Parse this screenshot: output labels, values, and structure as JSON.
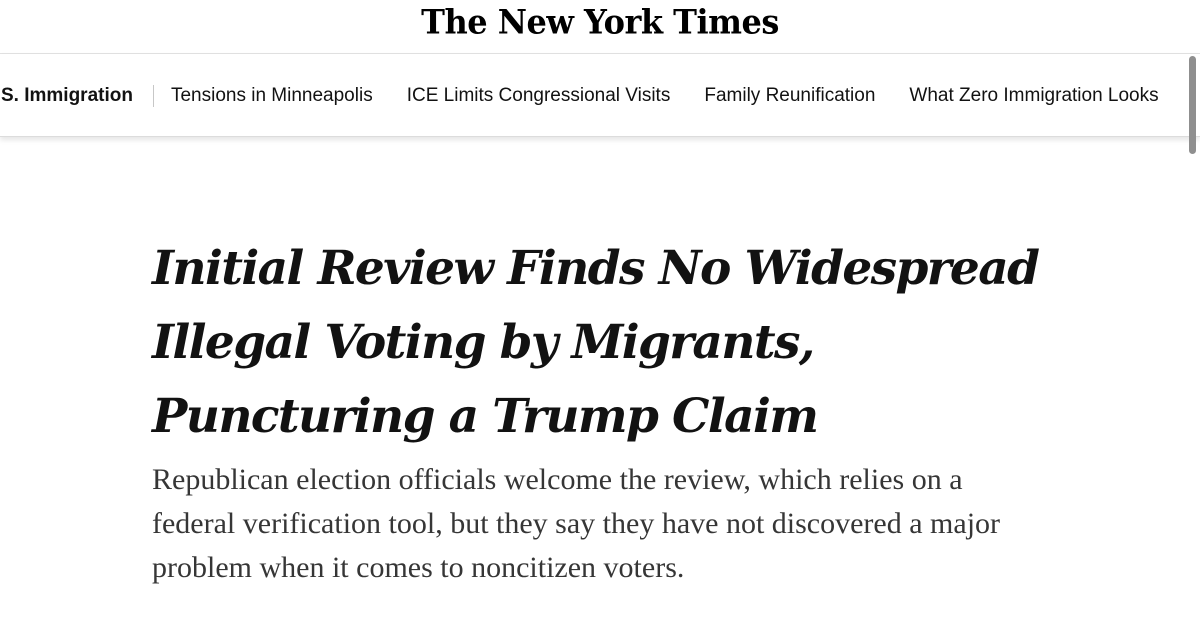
{
  "masthead": {
    "logo_text": "The New York Times"
  },
  "nav": {
    "section_label": "U.S. Immigration",
    "links": [
      {
        "label": "Tensions in Minneapolis"
      },
      {
        "label": "ICE Limits Congressional Visits"
      },
      {
        "label": "Family Reunification"
      },
      {
        "label": "What Zero Immigration Looks"
      }
    ]
  },
  "article": {
    "headline": "Initial Review Finds No Widespread Illegal Voting by Migrants, Puncturing a Trump Claim",
    "summary": "Republican election officials welcome the review, which relies on a federal verification tool, but they say they have not discovered a major problem when it comes to noncitizen voters."
  },
  "colors": {
    "text": "#121212",
    "summary_text": "#363636",
    "divider": "#e2e2e2"
  }
}
